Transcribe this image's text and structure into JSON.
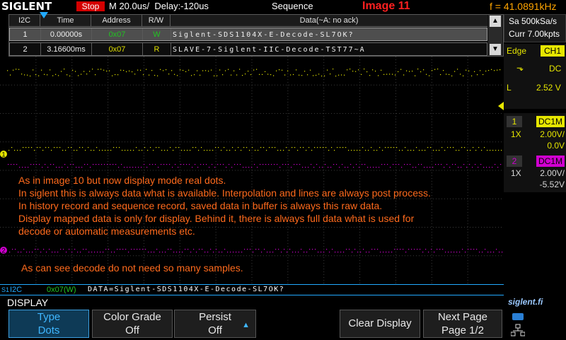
{
  "header": {
    "brand": "SIGLENT",
    "run_state": "Stop",
    "timebase": "M 20.0us/",
    "delay": "Delay:-120us",
    "mode": "Sequence",
    "overlay_title": "Image 11",
    "frequency": "f = 41.0891kHz"
  },
  "decode_table": {
    "columns": [
      "I2C",
      "Time",
      "Address",
      "R/W",
      "Data(~A: no ack)"
    ],
    "rows": [
      {
        "index": "1",
        "time": "0.00000s",
        "address": "0x07",
        "rw": "W",
        "data": "Siglent-SDS1104X-E-Decode-SL7OK?"
      },
      {
        "index": "2",
        "time": "3.16600ms",
        "address": "0x07",
        "rw": "R",
        "data": "SLAVE-7-Siglent-IIC-Decode-TST77~A"
      }
    ]
  },
  "acquisition": {
    "sample_rate": "Sa 500kSa/s",
    "memory": "Curr 7.00kpts"
  },
  "trigger": {
    "type": "Edge",
    "source": "CH1",
    "coupling": "DC",
    "level_label": "L",
    "level": "2.52 V"
  },
  "channel1": {
    "number": "1",
    "coupling": "DC1M",
    "probe": "1X",
    "scale": "2.00V/",
    "offset": "0.0V",
    "color": "#ffff00"
  },
  "channel2": {
    "number": "2",
    "coupling": "DC1M",
    "probe": "1X",
    "scale": "2.00V/",
    "offset": "-5.52V",
    "color": "#ff00ff"
  },
  "annotations": [
    "As in image 10 but now display mode real dots.",
    "In siglent this is always data what is available. Interpolation and lines are always post process.",
    "In history record and sequence record, saved data in buffer is always this raw data.",
    "Display mapped data is only for display. Behind it, there is always full data what is used for",
    "decode or automatic measurements etc.",
    "As can see decode do not need so many samples."
  ],
  "decode_bar": {
    "side_label": "S1",
    "protocol": "I2C",
    "address": "0x07(W)",
    "data": "DATA=Siglent-SDS1104X-E-Decode-SL7OK?"
  },
  "channel_markers": {
    "ch1": "1",
    "ch2": "2"
  },
  "menu": {
    "title": "DISPLAY",
    "buttons": [
      {
        "line1": "Type",
        "line2": "Dots"
      },
      {
        "line1": "Color Grade",
        "line2": "Off"
      },
      {
        "line1": "Persist",
        "line2": "Off"
      },
      {
        "line1": "Clear Display",
        "line2": ""
      },
      {
        "line1": "Next Page",
        "line2": "Page 1/2"
      }
    ]
  },
  "watermark": "siglent.fi",
  "colors": {
    "accent": "#22aaff",
    "stop": "#d40000",
    "frequency": "#ffa500",
    "annotation": "#ff6a1c",
    "decode_green": "#22c422"
  },
  "icons": [
    "scroll-up-icon",
    "scroll-down-icon",
    "trigger-edge-icon",
    "persist-up-icon",
    "usb-icon",
    "network-icon"
  ]
}
